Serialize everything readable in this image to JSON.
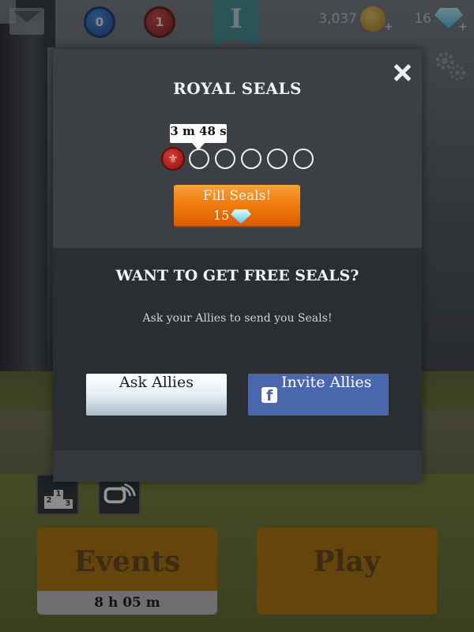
{
  "hud": {
    "blue_seal_count": "0",
    "red_seal_count": "1",
    "banner_letter": "I",
    "gold_amount": "3,037",
    "gem_amount": "16",
    "plus_symbol": "+"
  },
  "modal": {
    "title": "ROYAL SEALS",
    "timer": "3 m 48 s",
    "seals_filled": 1,
    "seals_total": 6,
    "fill_button": {
      "label": "Fill Seals!",
      "cost": "15"
    },
    "free_title": "WANT TO GET FREE SEALS?",
    "free_subtitle": "Ask your Allies to send you Seals!",
    "ask_button_label": "Ask Allies",
    "invite_button_label": "Invite Allies"
  },
  "bottom": {
    "ranking_podium": [
      "2",
      "1",
      "3"
    ],
    "events_label": "Events",
    "events_timer": "8 h 05 m",
    "play_label": "Play"
  }
}
